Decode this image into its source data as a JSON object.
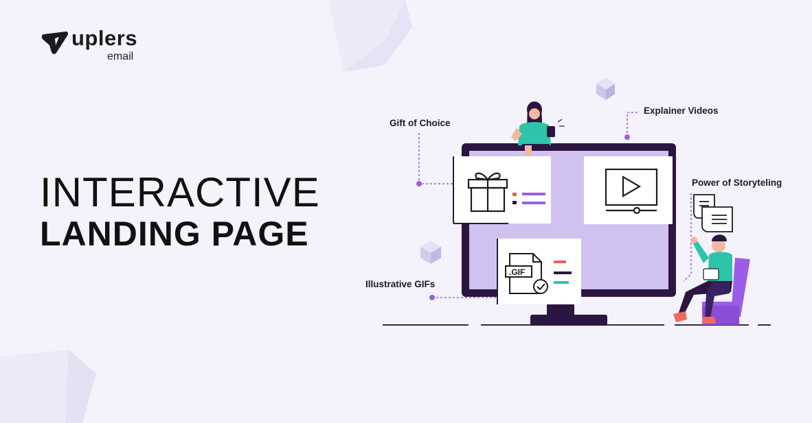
{
  "brand": {
    "name": "uplers",
    "sub": "email"
  },
  "headline": {
    "line1": "INTERACTIVE",
    "line2": "LANDING PAGE"
  },
  "features": {
    "gift": "Gift of Choice",
    "videos": "Explainer Videos",
    "storytelling": "Power of Storyteling",
    "gifs": "Illustrative GIFs",
    "gif_tag": ".GIF"
  },
  "colors": {
    "background": "#f4f2fa",
    "accent": "#9b5de5",
    "monitor_frame": "#2d1542",
    "monitor_screen": "#cfc2f0",
    "teal": "#2ec4a9",
    "coral": "#ef6b5b"
  }
}
